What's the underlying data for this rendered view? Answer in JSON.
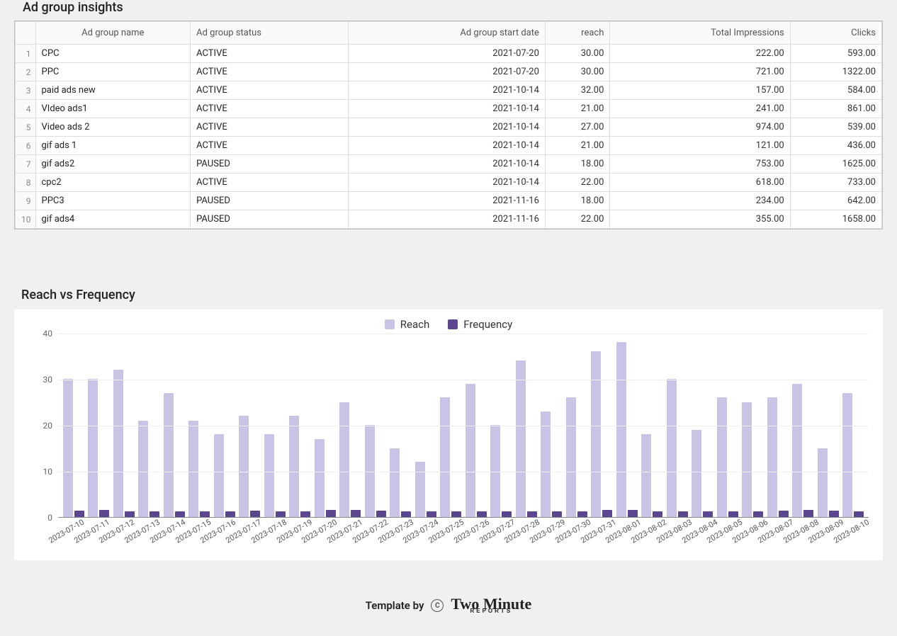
{
  "table": {
    "title": "Ad group insights",
    "columns": [
      "Ad group name",
      "Ad group status",
      "Ad group start date",
      "reach",
      "Total Impressions",
      "Clicks"
    ],
    "rows": [
      {
        "idx": 1,
        "name": "CPC",
        "status": "ACTIVE",
        "date": "2021-07-20",
        "reach": "30.00",
        "impressions": "222.00",
        "clicks": "593.00"
      },
      {
        "idx": 2,
        "name": "PPC",
        "status": "ACTIVE",
        "date": "2021-07-20",
        "reach": "30.00",
        "impressions": "721.00",
        "clicks": "1322.00"
      },
      {
        "idx": 3,
        "name": "paid ads new",
        "status": "ACTIVE",
        "date": "2021-10-14",
        "reach": "32.00",
        "impressions": "157.00",
        "clicks": "584.00"
      },
      {
        "idx": 4,
        "name": "VIdeo ads1",
        "status": "ACTIVE",
        "date": "2021-10-14",
        "reach": "21.00",
        "impressions": "241.00",
        "clicks": "861.00"
      },
      {
        "idx": 5,
        "name": "Video ads 2",
        "status": "ACTIVE",
        "date": "2021-10-14",
        "reach": "27.00",
        "impressions": "974.00",
        "clicks": "539.00"
      },
      {
        "idx": 6,
        "name": "gif ads 1",
        "status": "ACTIVE",
        "date": "2021-10-14",
        "reach": "21.00",
        "impressions": "121.00",
        "clicks": "436.00"
      },
      {
        "idx": 7,
        "name": "gif ads2",
        "status": "PAUSED",
        "date": "2021-10-14",
        "reach": "18.00",
        "impressions": "753.00",
        "clicks": "1625.00"
      },
      {
        "idx": 8,
        "name": "cpc2",
        "status": "ACTIVE",
        "date": "2021-10-14",
        "reach": "22.00",
        "impressions": "618.00",
        "clicks": "733.00"
      },
      {
        "idx": 9,
        "name": "PPC3",
        "status": "PAUSED",
        "date": "2021-11-16",
        "reach": "18.00",
        "impressions": "234.00",
        "clicks": "642.00"
      },
      {
        "idx": 10,
        "name": "gif ads4",
        "status": "PAUSED",
        "date": "2021-11-16",
        "reach": "22.00",
        "impressions": "355.00",
        "clicks": "1658.00"
      }
    ]
  },
  "chart": {
    "title": "Reach vs Frequency",
    "legend": {
      "reach": "Reach",
      "frequency": "Frequency"
    },
    "ymax": 40,
    "yticks": [
      0,
      10,
      20,
      30,
      40
    ]
  },
  "chart_data": {
    "type": "bar",
    "title": "Reach vs Frequency",
    "xlabel": "",
    "ylabel": "",
    "ylim": [
      0,
      40
    ],
    "categories": [
      "2023-07-10",
      "2023-07-11",
      "2023-07-12",
      "2023-07-13",
      "2023-07-14",
      "2023-07-15",
      "2023-07-16",
      "2023-07-17",
      "2023-07-18",
      "2023-07-19",
      "2023-07-20",
      "2023-07-21",
      "2023-07-22",
      "2023-07-23",
      "2023-07-24",
      "2023-07-25",
      "2023-07-26",
      "2023-07-27",
      "2023-07-28",
      "2023-07-29",
      "2023-07-30",
      "2023-07-31",
      "2023-08-01",
      "2023-08-02",
      "2023-08-03",
      "2023-08-04",
      "2023-08-05",
      "2023-08-06",
      "2023-08-07",
      "2023-08-08",
      "2023-08-09",
      "2023-08-10"
    ],
    "series": [
      {
        "name": "Reach",
        "color": "#c9c3e5",
        "values": [
          30,
          30,
          32,
          21,
          27,
          21,
          18,
          22,
          18,
          22,
          17,
          25,
          20,
          15,
          12,
          26,
          29,
          20,
          34,
          23,
          26,
          36,
          38,
          18,
          30,
          19,
          26,
          25,
          26,
          29,
          15,
          27
        ]
      },
      {
        "name": "Frequency",
        "color": "#5b468f",
        "values": [
          1.4,
          1.5,
          1.3,
          1.3,
          1.2,
          1.3,
          1.3,
          1.4,
          1.3,
          1.2,
          1.5,
          1.5,
          1.4,
          1.2,
          1.2,
          1.2,
          1.3,
          1.2,
          1.2,
          1.2,
          1.2,
          1.5,
          1.5,
          1.3,
          1.3,
          1.3,
          1.3,
          1.3,
          1.4,
          1.5,
          1.4,
          1.3
        ]
      }
    ]
  },
  "footer": {
    "prefix": "Template by",
    "cc": "C",
    "brand_top": "Two Minute",
    "brand_bottom": "REPORTS"
  }
}
